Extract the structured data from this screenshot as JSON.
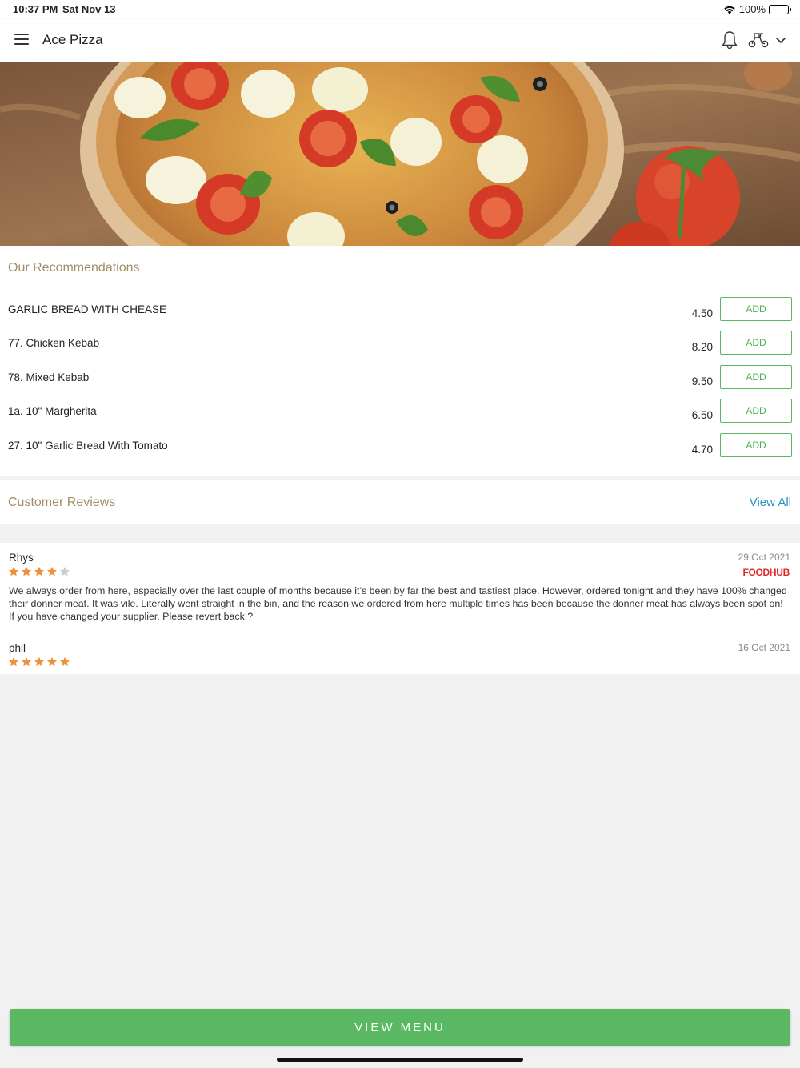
{
  "status_bar": {
    "time": "10:37 PM",
    "date": "Sat Nov 13",
    "battery": "100%"
  },
  "header": {
    "title": "Ace Pizza",
    "icons": [
      "menu-icon",
      "bell-icon",
      "scooter-icon",
      "chevron-down-icon"
    ]
  },
  "recommendations": {
    "title": "Our Recommendations",
    "add_label": "ADD",
    "items": [
      {
        "name": "GARLIC BREAD WITH CHEASE",
        "price": "4.50"
      },
      {
        "name": "77. Chicken Kebab",
        "price": "8.20"
      },
      {
        "name": "78. Mixed Kebab",
        "price": "9.50"
      },
      {
        "name": "1a. 10\" Margherita",
        "price": "6.50"
      },
      {
        "name": "27. 10\" Garlic Bread With Tomato",
        "price": "4.70"
      }
    ]
  },
  "reviews": {
    "title": "Customer Reviews",
    "view_all": "View All",
    "items": [
      {
        "name": "Rhys",
        "date": "29 Oct 2021",
        "rating": 4,
        "source": "FOODHUB",
        "text": "We always order from here, especially over the last couple of months because it’s been by far the best and tastiest place. However, ordered tonight and they have 100% changed their donner meat. It was vile. Literally went straight in the bin, and the reason we ordered from here multiple times has been because the donner meat has always been spot on! If you have changed your supplier. Please revert back ?"
      },
      {
        "name": "phil",
        "date": "16 Oct 2021",
        "rating": 5,
        "source": "",
        "text": ""
      }
    ]
  },
  "footer": {
    "view_menu": "VIEW MENU"
  },
  "colors": {
    "accent_green": "#5bb862",
    "section_title": "#a48c68",
    "link_blue": "#2a8fc1",
    "star_orange": "#f0903a",
    "star_empty": "#cccccc",
    "foodhub_red": "#e02b2b"
  }
}
